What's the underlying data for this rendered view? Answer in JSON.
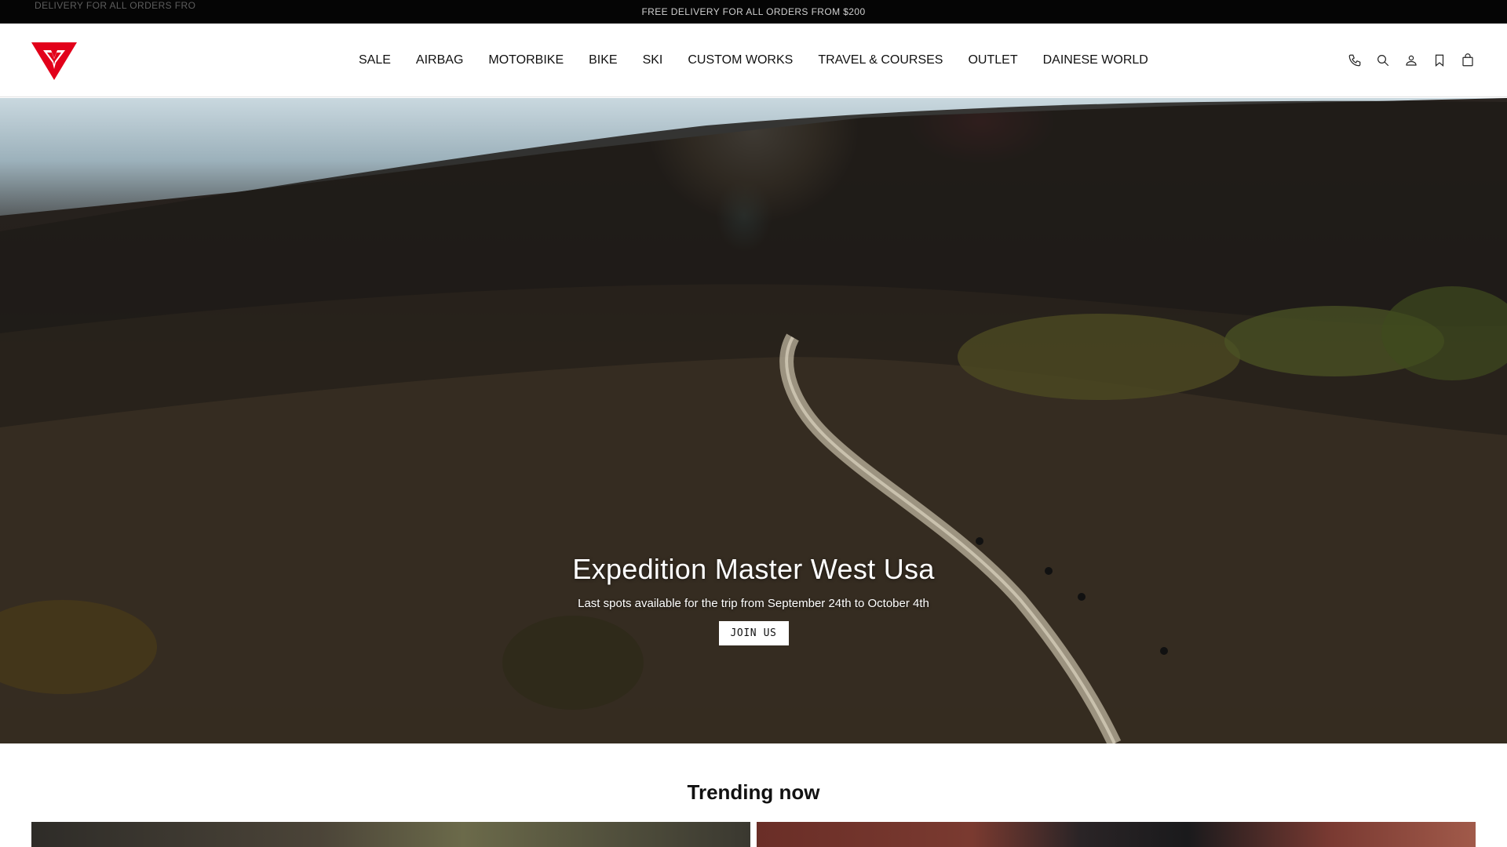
{
  "announcement": {
    "text": "Free delivery for all orders from $200",
    "ghost_text": "Delivery for all orders fro"
  },
  "header": {
    "logo_alt": "Dainese",
    "nav": [
      {
        "label": "SALE",
        "highlight": true
      },
      {
        "label": "AIRBAG"
      },
      {
        "label": "MOTORBIKE"
      },
      {
        "label": "BIKE"
      },
      {
        "label": "SKI"
      },
      {
        "label": "CUSTOM WORKS"
      },
      {
        "label": "TRAVEL & COURSES"
      },
      {
        "label": "OUTLET"
      },
      {
        "label": "DAINESE WORLD"
      }
    ],
    "tools": [
      "phone-icon",
      "search-icon",
      "account-icon",
      "wishlist-icon",
      "cart-icon"
    ]
  },
  "hero": {
    "title": "Expedition Master West Usa",
    "subtitle": "Last spots available for the trip from September 24th to October 4th",
    "cta": "JOIN US"
  },
  "trending": {
    "title": "Trending now"
  },
  "colors": {
    "brand_red": "#e2001a",
    "sale_red": "#c8102e",
    "announce_bg": "#050505"
  }
}
